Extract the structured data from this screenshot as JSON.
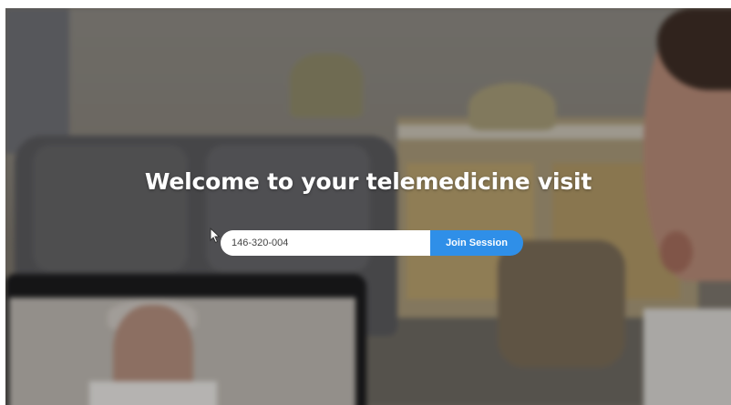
{
  "page": {
    "title": "Welcome to your telemedicine visit"
  },
  "join_form": {
    "session_id_value": "146-320-004",
    "join_label": "Join Session"
  },
  "colors": {
    "join_button": "#2f8fe8",
    "title_text": "#ffffff"
  },
  "icons": {
    "cursor": "mouse-pointer-icon"
  }
}
